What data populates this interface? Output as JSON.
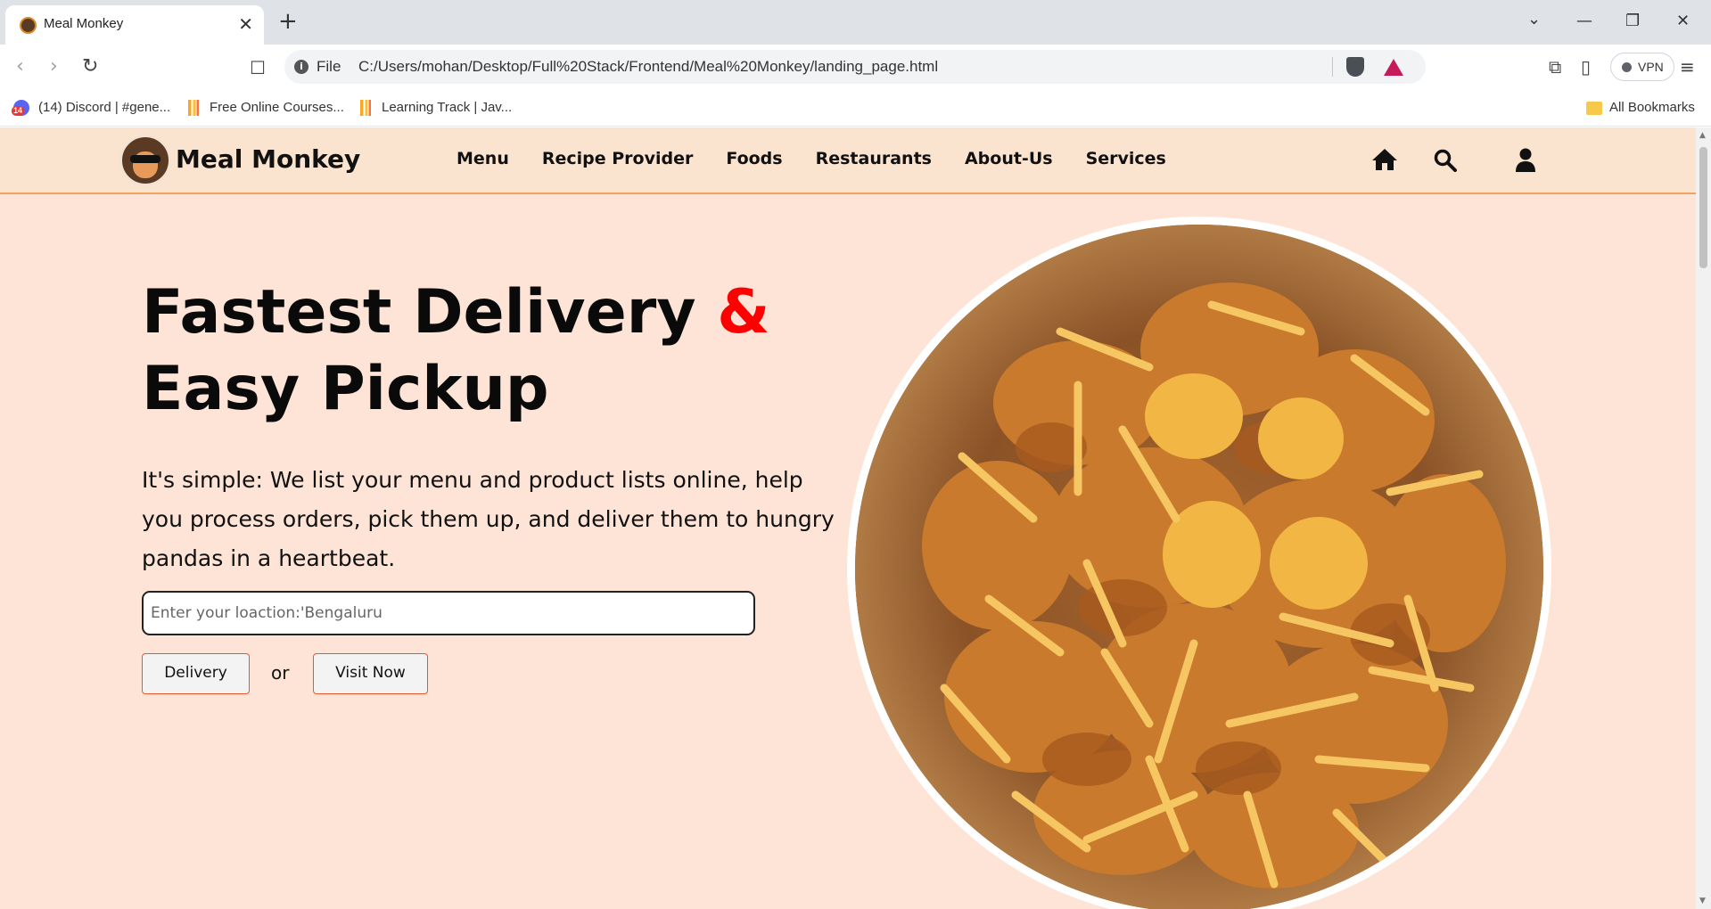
{
  "browser": {
    "tab_title": "Meal Monkey",
    "tab_close": "✕",
    "new_tab": "+",
    "window_controls": {
      "dropdown": "⌄",
      "minimize": "—",
      "restore": "❐",
      "close": "✕"
    },
    "url_scheme": "File",
    "url": "C:/Users/mohan/Desktop/Full%20Stack/Frontend/Meal%20Monkey/landing_page.html",
    "vpn_label": "VPN",
    "bookmarks": [
      {
        "label": "(14) Discord | #gene...",
        "icon": "discord-icon",
        "badge": "14"
      },
      {
        "label": "Free Online Courses...",
        "icon": "bars-icon"
      },
      {
        "label": "Learning Track | Jav...",
        "icon": "bars-icon"
      }
    ],
    "all_bookmarks": "All Bookmarks"
  },
  "site": {
    "brand": "Meal Monkey",
    "nav": [
      "Menu",
      "Recipe Provider",
      "Foods",
      "Restaurants",
      "About-Us",
      "Services"
    ],
    "nav_icons": [
      "home-icon",
      "search-icon",
      "user-icon"
    ]
  },
  "hero": {
    "headline_part1": "Fastest Delivery",
    "headline_amp": "&",
    "headline_part2": "Easy Pickup",
    "lead": "It's simple: We list your menu and product lists online, help you process orders, pick them up, and deliver them to hungry pandas in a heartbeat.",
    "location_placeholder": "Enter your loaction:'Bengaluru",
    "delivery_label": "Delivery",
    "or_label": "or",
    "visit_label": "Visit Now"
  },
  "colors": {
    "page_bg": "#fde4d6",
    "nav_bg": "#fbe4cf",
    "accent_amp": "#ff0000",
    "button_border": "#e8562a"
  }
}
